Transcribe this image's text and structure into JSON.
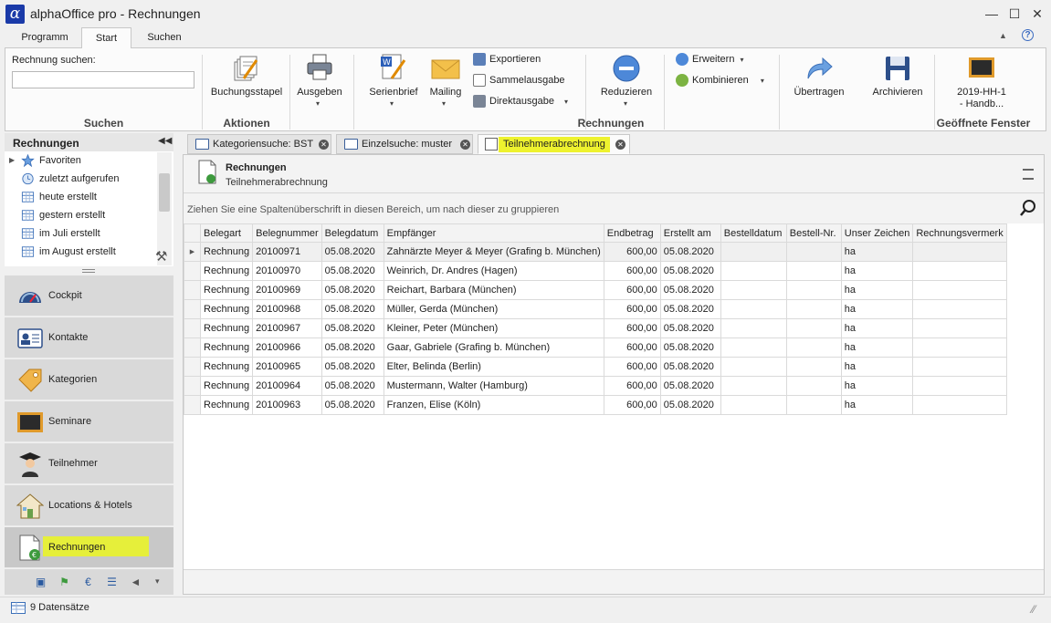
{
  "window": {
    "title": "alphaOffice pro - Rechnungen",
    "logo_char": "α",
    "minimize": "—",
    "maximize": "☐",
    "close": "✕"
  },
  "ribbon_tabs": [
    "Programm",
    "Start",
    "Suchen"
  ],
  "ribbon_right": {
    "collapse": "▲",
    "help": "?"
  },
  "ribbon": {
    "search_label": "Rechnung suchen:",
    "search_value": "",
    "groups": {
      "suchen": "Suchen",
      "aktionen": "Aktionen",
      "rechnungen": "Rechnungen",
      "fenster": "Geöffnete Fenster"
    },
    "buttons": {
      "buchungsstapel": "Buchungsstapel",
      "ausgeben": "Ausgeben",
      "serienbrief": "Serienbrief",
      "mailing": "Mailing",
      "exportieren": "Exportieren",
      "sammelausgabe": "Sammelausgabe",
      "direktausgabe": "Direktausgabe",
      "reduzieren": "Reduzieren",
      "erweitern": "Erweitern",
      "kombinieren": "Kombinieren",
      "uebertragen": "Übertragen",
      "archivieren": "Archivieren",
      "fenster_line1": "2019-HH-1",
      "fenster_line2": "- Handb..."
    },
    "dropdown_arrow": "▾"
  },
  "nav": {
    "header": "Rechnungen",
    "collapse": "◀◀",
    "tree": [
      {
        "label": "Favoriten",
        "icon": "star-icon"
      },
      {
        "label": "zuletzt aufgerufen",
        "icon": "clock-icon"
      },
      {
        "label": "heute erstellt",
        "icon": "calendar-icon"
      },
      {
        "label": "gestern erstellt",
        "icon": "calendar-icon"
      },
      {
        "label": "im Juli erstellt",
        "icon": "calendar-icon"
      },
      {
        "label": "im August erstellt",
        "icon": "calendar-icon"
      }
    ],
    "tree_expander": "▶",
    "tools_icon": "⚒",
    "buttons": [
      {
        "label": "Cockpit",
        "icon": "gauge-icon"
      },
      {
        "label": "Kontakte",
        "icon": "contact-card-icon"
      },
      {
        "label": "Kategorien",
        "icon": "tag-icon"
      },
      {
        "label": "Seminare",
        "icon": "board-icon"
      },
      {
        "label": "Teilnehmer",
        "icon": "graduate-icon"
      },
      {
        "label": "Locations & Hotels",
        "icon": "house-icon"
      },
      {
        "label": "Rechnungen",
        "icon": "invoice-icon"
      }
    ],
    "bottom_more": "▾"
  },
  "doc_tabs": [
    {
      "label": "Kategoriensuche: BST"
    },
    {
      "label": "Einzelsuche: muster"
    },
    {
      "label": "Teilnehmerabrechnung"
    }
  ],
  "tab_close": "✕",
  "document": {
    "title": "Rechnungen",
    "subtitle": "Teilnehmerabrechnung",
    "group_hint": "Ziehen Sie eine Spaltenüberschrift in diesen Bereich, um nach dieser zu gruppieren",
    "search_icon": "⚲"
  },
  "grid": {
    "columns": [
      "Belegart",
      "Belegnummer",
      "Belegdatum",
      "Empfänger",
      "Endbetrag",
      "Erstellt am",
      "Bestelldatum",
      "Bestell-Nr.",
      "Unser Zeichen",
      "Rechnungsvermerk"
    ],
    "rows": [
      [
        "Rechnung",
        "20100971",
        "05.08.2020",
        "Zahnärzte Meyer & Meyer (Grafing b. München)",
        "600,00",
        "05.08.2020",
        "",
        "",
        "ha",
        ""
      ],
      [
        "Rechnung",
        "20100970",
        "05.08.2020",
        "Weinrich, Dr. Andres (Hagen)",
        "600,00",
        "05.08.2020",
        "",
        "",
        "ha",
        ""
      ],
      [
        "Rechnung",
        "20100969",
        "05.08.2020",
        "Reichart, Barbara (München)",
        "600,00",
        "05.08.2020",
        "",
        "",
        "ha",
        ""
      ],
      [
        "Rechnung",
        "20100968",
        "05.08.2020",
        "Müller, Gerda (München)",
        "600,00",
        "05.08.2020",
        "",
        "",
        "ha",
        ""
      ],
      [
        "Rechnung",
        "20100967",
        "05.08.2020",
        "Kleiner, Peter (München)",
        "600,00",
        "05.08.2020",
        "",
        "",
        "ha",
        ""
      ],
      [
        "Rechnung",
        "20100966",
        "05.08.2020",
        "Gaar, Gabriele (Grafing b. München)",
        "600,00",
        "05.08.2020",
        "",
        "",
        "ha",
        ""
      ],
      [
        "Rechnung",
        "20100965",
        "05.08.2020",
        "Elter, Belinda (Berlin)",
        "600,00",
        "05.08.2020",
        "",
        "",
        "ha",
        ""
      ],
      [
        "Rechnung",
        "20100964",
        "05.08.2020",
        "Mustermann, Walter (Hamburg)",
        "600,00",
        "05.08.2020",
        "",
        "",
        "ha",
        ""
      ],
      [
        "Rechnung",
        "20100963",
        "05.08.2020",
        "Franzen, Elise (Köln)",
        "600,00",
        "05.08.2020",
        "",
        "",
        "ha",
        ""
      ]
    ],
    "selected_row": 0,
    "row_indicator": "▶"
  },
  "status": {
    "text": "9 Datensätze",
    "resize_grip": "⁄⁄"
  },
  "colors": {
    "highlight": "#e6ef3a",
    "accent_blue": "#1a3aa8",
    "nav_bg": "#d9d9d9"
  }
}
